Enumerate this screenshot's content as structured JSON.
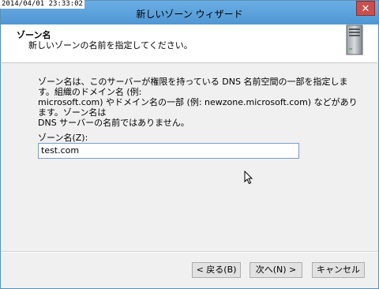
{
  "overlay": {
    "timestamp": "2014/04/01 23:33:02"
  },
  "window": {
    "title": "新しいゾーン ウィザード",
    "close_glyph": "✕"
  },
  "header": {
    "title": "ゾーン名",
    "description": "新しいゾーンの名前を指定してください。",
    "icon": "server-icon"
  },
  "main": {
    "description_lines": [
      "ゾーン名は、このサーバーが権限を持っている DNS 名前空間の一部を指定します。組織のドメイン名 (例:",
      "microsoft.com) やドメイン名の一部 (例: newzone.microsoft.com) などがあります。ゾーン名は",
      "DNS サーバーの名前ではありません。"
    ],
    "zone_label": "ゾーン名(Z):",
    "zone_value": "test.com"
  },
  "footer": {
    "back_label": "< 戻る(B)",
    "next_label": "次へ(N) >",
    "cancel_label": "キャンセル"
  },
  "colors": {
    "titlebar": "#5b9bd5",
    "close": "#c75050",
    "input_border": "#7a9cc7"
  }
}
